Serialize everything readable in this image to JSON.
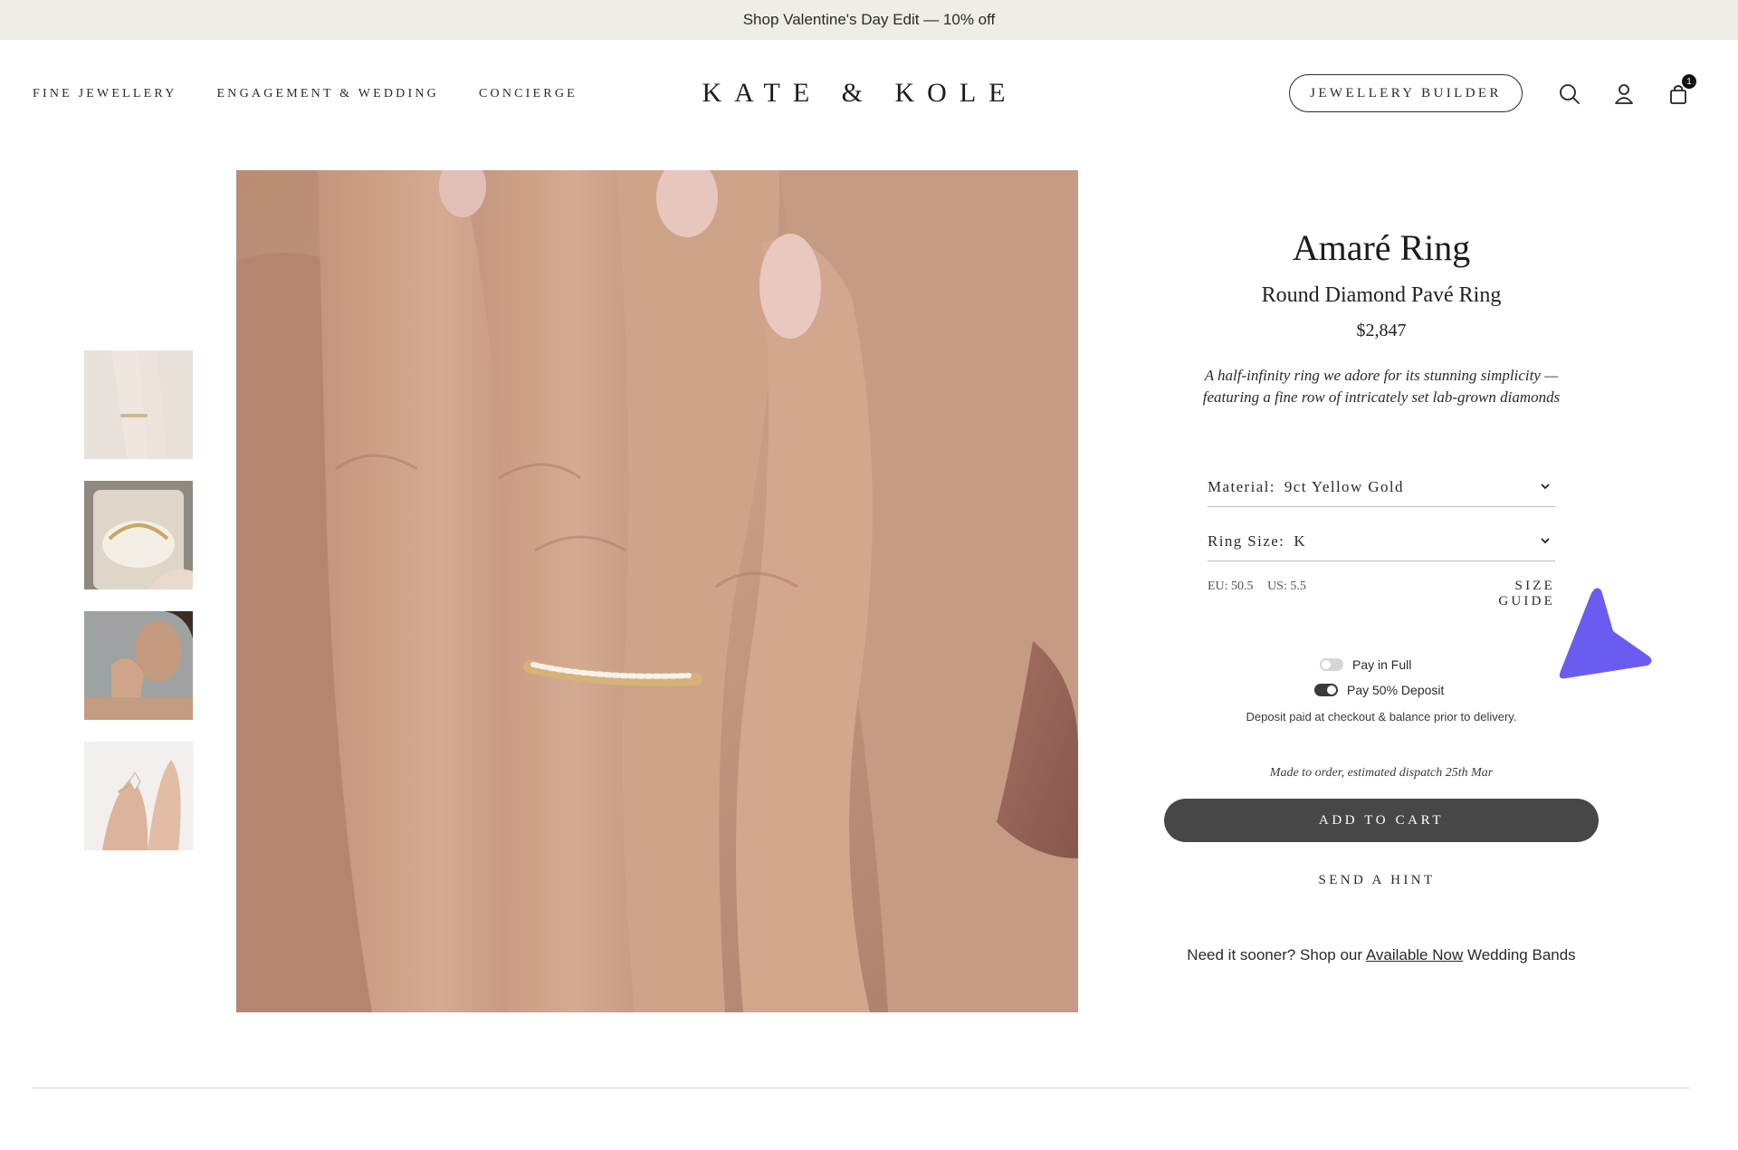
{
  "announcement": {
    "text": "Shop Valentine's Day Edit — 10% off"
  },
  "nav": {
    "items": [
      {
        "label": "FINE JEWELLERY"
      },
      {
        "label": "ENGAGEMENT & WEDDING"
      },
      {
        "label": "CONCIERGE"
      }
    ]
  },
  "brand": {
    "logo": "KATE & KOLE"
  },
  "header_actions": {
    "builder_label": "JEWELLERY BUILDER",
    "search_icon": "search-icon",
    "account_icon": "account-icon",
    "cart_icon": "shopping-bag-icon",
    "cart_count": "1"
  },
  "gallery": {
    "thumbnails": [
      {
        "icon": "thumbnail-hand-ring-light"
      },
      {
        "icon": "thumbnail-ring-box"
      },
      {
        "icon": "thumbnail-model-portrait"
      },
      {
        "icon": "thumbnail-hand-marquise-ring"
      }
    ],
    "main_image": "hand-wearing-pave-ring-photo"
  },
  "product": {
    "title": "Amaré Ring",
    "subtitle": "Round Diamond Pavé Ring",
    "price": "$2,847",
    "description": "A half-infinity ring we adore for its stunning simplicity — featuring a fine row of intricately set lab-grown diamonds",
    "material": {
      "label": "Material:",
      "value": "9ct Yellow Gold"
    },
    "ring_size": {
      "label": "Ring Size:",
      "value": "K"
    },
    "size_eu": "EU: 50.5",
    "size_us": "US: 5.5",
    "size_guide": "SIZE GUIDE",
    "payment": {
      "full_label": "Pay in Full",
      "deposit_label": "Pay 50% Deposit",
      "selected": "Pay 50% Deposit",
      "note": "Deposit paid at checkout & balance prior to delivery."
    },
    "dispatch": "Made to order, estimated dispatch 25th Mar",
    "add_to_cart": "ADD TO CART",
    "send_hint": "SEND A HINT",
    "sooner_prefix": "Need it sooner? Shop our ",
    "sooner_link": "Available Now",
    "sooner_suffix": " Wedding Bands"
  },
  "colors": {
    "announcement_bg": "#efede6",
    "button_dark": "#474747",
    "cursor_accent": "#6b5cf0"
  }
}
